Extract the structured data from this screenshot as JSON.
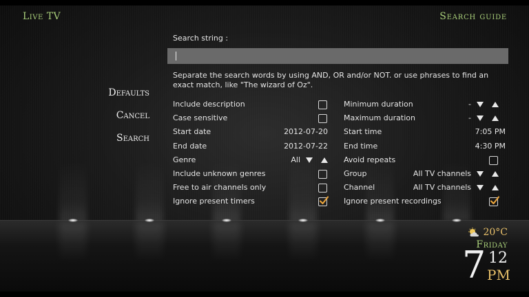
{
  "header": {
    "section": "Live TV",
    "title": "Search guide"
  },
  "side_menu": {
    "items": [
      "Defaults",
      "Cancel",
      "Search"
    ]
  },
  "search": {
    "label": "Search string :",
    "value": ""
  },
  "hint": "Separate the search words by using AND, OR and/or NOT. or use phrases to find an exact match, like \"The wizard of Oz\".",
  "left_options": {
    "include_description": {
      "label": "Include description",
      "checked": false
    },
    "case_sensitive": {
      "label": "Case sensitive",
      "checked": false
    },
    "start_date": {
      "label": "Start date",
      "value": "2012-07-20"
    },
    "end_date": {
      "label": "End date",
      "value": "2012-07-22"
    },
    "genre": {
      "label": "Genre",
      "value": "All"
    },
    "include_unknown_genres": {
      "label": "Include unknown genres",
      "checked": false
    },
    "free_to_air": {
      "label": "Free to air channels only",
      "checked": false
    },
    "ignore_present_timers": {
      "label": "Ignore present timers",
      "checked": true
    }
  },
  "right_options": {
    "minimum_duration": {
      "label": "Minimum duration",
      "value": "-"
    },
    "maximum_duration": {
      "label": "Maximum duration",
      "value": "-"
    },
    "start_time": {
      "label": "Start time",
      "value": "7:05 PM"
    },
    "end_time": {
      "label": "End time",
      "value": "4:30 PM"
    },
    "avoid_repeats": {
      "label": "Avoid repeats",
      "checked": false
    },
    "group": {
      "label": "Group",
      "value": "All TV channels"
    },
    "channel": {
      "label": "Channel",
      "value": "All TV channels"
    },
    "ignore_present_recordings": {
      "label": "Ignore present recordings",
      "checked": true
    }
  },
  "clock": {
    "temperature": "20°C",
    "day": "Friday",
    "hour": "7",
    "minute": "12",
    "ampm": "PM",
    "weather_icon": "partly-cloudy-icon"
  },
  "colors": {
    "accent_green": "#a9cf7a",
    "accent_orange": "#e8c06a",
    "input_bg": "#6a6a6a",
    "checkmark": "#e8a23a"
  }
}
